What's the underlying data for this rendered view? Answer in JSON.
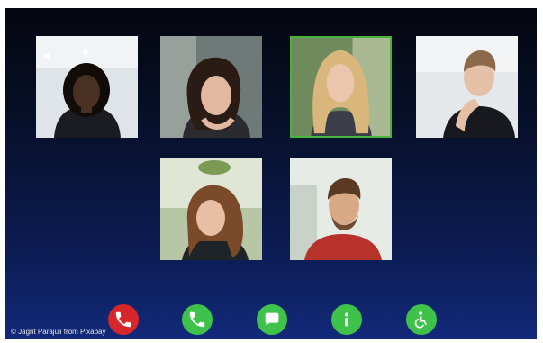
{
  "participants": [
    {
      "id": "p1",
      "skin": "#4a3022",
      "hair": "#120c09",
      "top": "#1b1b22",
      "bg": "#d9dfe4",
      "bg2": "#eef1f3"
    },
    {
      "id": "p2",
      "skin": "#e2b9a0",
      "hair": "#2a1b14",
      "top": "#2b2a2e",
      "bg": "#6f7a78",
      "bg2": "#98a09c"
    },
    {
      "id": "p3",
      "skin": "#ecc6ac",
      "hair": "#d9b77c",
      "top": "#3b3e48",
      "bg": "#6f8a5c",
      "bg2": "#a9b893",
      "active": true
    },
    {
      "id": "p4",
      "skin": "#e4c1a6",
      "hair": "#8b6a4c",
      "top": "#17191f",
      "bg": "#d6dbe0",
      "bg2": "#f0f2f4"
    },
    {
      "id": "p5",
      "skin": "#e8bfa4",
      "hair": "#7a4a2a",
      "top": "#1f2428",
      "bg": "#b7c6a4",
      "bg2": "#dfe6d3"
    },
    {
      "id": "p6",
      "skin": "#d9a986",
      "hair": "#5a3a22",
      "top": "#b7322a",
      "bg": "#c9d2c8",
      "bg2": "#e6ece5"
    }
  ],
  "controls": [
    {
      "name": "end-call-button",
      "icon": "phone-hangup-icon",
      "color": "#d8272b"
    },
    {
      "name": "call-button",
      "icon": "phone-icon",
      "color": "#3ec24a"
    },
    {
      "name": "chat-button",
      "icon": "chat-icon",
      "color": "#3ec24a"
    },
    {
      "name": "info-button",
      "icon": "info-icon",
      "color": "#3ec24a"
    },
    {
      "name": "accessibility-button",
      "icon": "wheelchair-icon",
      "color": "#3ec24a"
    }
  ],
  "credit": "© Jagrit Parajuli from Pixabay",
  "colors": {
    "active_border": "#49b23c"
  }
}
